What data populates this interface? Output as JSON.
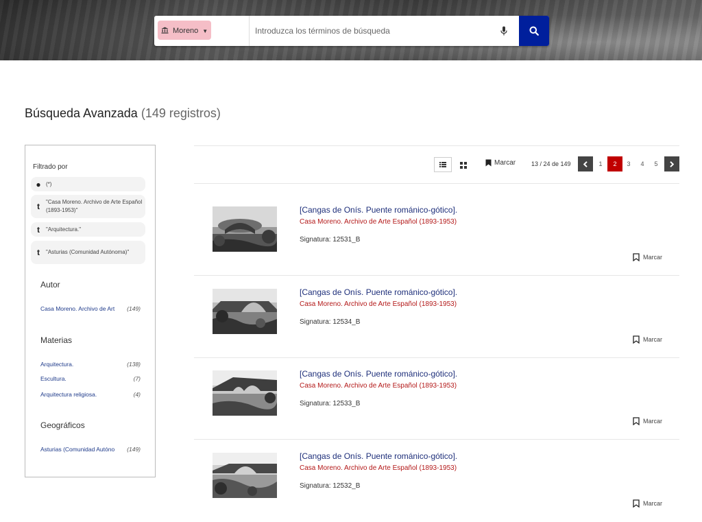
{
  "search": {
    "scope_label": "Moreno",
    "placeholder": "Introduzca los términos de búsqueda",
    "icons": {
      "scope": "museum-icon",
      "mic": "microphone-icon",
      "search": "search-icon"
    }
  },
  "header": {
    "title": "Búsqueda Avanzada",
    "count": "(149 registros)"
  },
  "sidebar": {
    "filter_title": "Filtrado por",
    "chips": [
      {
        "icon": "●",
        "text": "(*)"
      },
      {
        "icon": "t",
        "text": "\"Casa Moreno. Archivo de Arte Español (1893-1953)\""
      },
      {
        "icon": "t",
        "text": "\"Arquitectura.\""
      },
      {
        "icon": "t",
        "text": "\"Asturias (Comunidad Autónoma)\""
      }
    ],
    "sections": [
      {
        "title": "Autor",
        "items": [
          {
            "label": "Casa Moreno. Archivo de Art",
            "count": "(149)"
          }
        ]
      },
      {
        "title": "Materias",
        "items": [
          {
            "label": "Arquitectura.",
            "count": "(138)"
          },
          {
            "label": "Escultura.",
            "count": "(7)"
          },
          {
            "label": "Arquitectura religiosa.",
            "count": "(4)"
          }
        ]
      },
      {
        "title": "Geográficos",
        "items": [
          {
            "label": "Asturias (Comunidad Autóno",
            "count": "(149)"
          }
        ]
      }
    ]
  },
  "toolbar": {
    "marcar_label": "Marcar",
    "range": "13 / 24 de 149",
    "pages": [
      "1",
      "2",
      "3",
      "4",
      "5"
    ],
    "current_page": "2"
  },
  "results": [
    {
      "title": "[Cangas de Onís. Puente románico-gótico].",
      "org": "Casa Moreno. Archivo de Arte Español (1893-1953)",
      "sig_label": "Signatura:",
      "sig": "12531_B",
      "marcar": "Marcar"
    },
    {
      "title": "[Cangas de Onís. Puente románico-gótico].",
      "org": "Casa Moreno. Archivo de Arte Español (1893-1953)",
      "sig_label": "Signatura:",
      "sig": "12534_B",
      "marcar": "Marcar"
    },
    {
      "title": "[Cangas de Onís. Puente románico-gótico].",
      "org": "Casa Moreno. Archivo de Arte Español (1893-1953)",
      "sig_label": "Signatura:",
      "sig": "12533_B",
      "marcar": "Marcar"
    },
    {
      "title": "[Cangas de Onís. Puente románico-gótico].",
      "org": "Casa Moreno. Archivo de Arte Español (1893-1953)",
      "sig_label": "Signatura:",
      "sig": "12532_B",
      "marcar": "Marcar"
    }
  ],
  "colors": {
    "search_button": "#001f9c",
    "active_page": "#c00000",
    "link": "#1e2f7a",
    "org": "#b31818"
  }
}
